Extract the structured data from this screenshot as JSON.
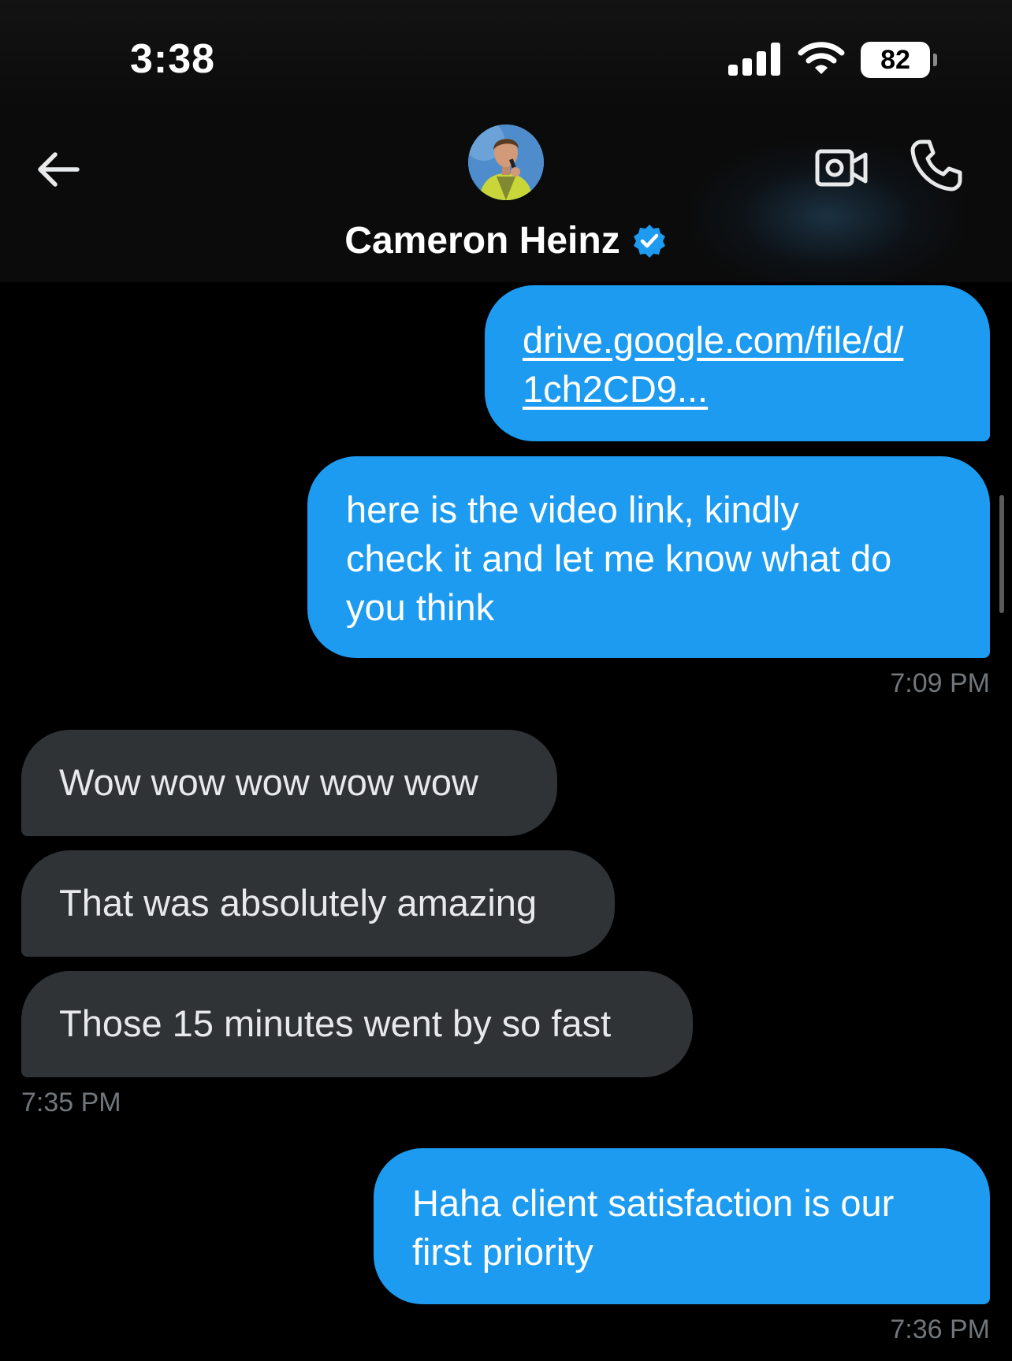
{
  "status_bar": {
    "time": "3:38",
    "battery": "82"
  },
  "header": {
    "contact_name": "Cameron Heinz",
    "verified": true,
    "icons": [
      "back-arrow-icon",
      "video-call-icon",
      "phone-icon",
      "verified-badge-icon"
    ]
  },
  "colors": {
    "outgoing_bubble": "#1d9bf0",
    "incoming_bubble": "#2f3336",
    "timestamp": "#71767b"
  },
  "messages": [
    {
      "direction": "outgoing",
      "line1": "drive.google.com/file/d/",
      "line2": "1ch2CD9..."
    },
    {
      "direction": "outgoing",
      "line1": "here is the video link, kindly",
      "line2": "check it and let me know what do",
      "line3": "you think",
      "time": "7:09 PM"
    },
    {
      "direction": "incoming",
      "text": "Wow wow wow wow wow"
    },
    {
      "direction": "incoming",
      "text": "That was absolutely amazing"
    },
    {
      "direction": "incoming",
      "text": "Those 15 minutes went by so fast",
      "time": "7:35 PM"
    },
    {
      "direction": "outgoing",
      "line1": "Haha client satisfaction is our",
      "line2": "first priority",
      "time": "7:36 PM"
    }
  ]
}
